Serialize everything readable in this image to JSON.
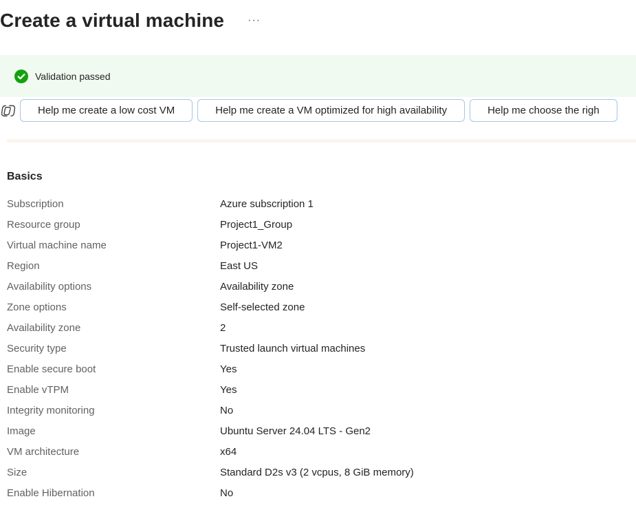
{
  "header": {
    "title": "Create a virtual machine",
    "more_label": "···"
  },
  "validation": {
    "text": "Validation passed",
    "color": "#13a10e"
  },
  "copilot": {
    "suggestions": [
      "Help me create a low cost VM",
      "Help me create a VM optimized for high availability",
      "Help me choose the righ"
    ]
  },
  "basics": {
    "heading": "Basics",
    "rows": [
      {
        "label": "Subscription",
        "value": "Azure subscription 1"
      },
      {
        "label": "Resource group",
        "value": "Project1_Group"
      },
      {
        "label": "Virtual machine name",
        "value": "Project1-VM2"
      },
      {
        "label": "Region",
        "value": "East US"
      },
      {
        "label": "Availability options",
        "value": "Availability zone"
      },
      {
        "label": "Zone options",
        "value": "Self-selected zone"
      },
      {
        "label": "Availability zone",
        "value": "2"
      },
      {
        "label": "Security type",
        "value": "Trusted launch virtual machines"
      },
      {
        "label": "Enable secure boot",
        "value": "Yes"
      },
      {
        "label": "Enable vTPM",
        "value": "Yes"
      },
      {
        "label": "Integrity monitoring",
        "value": "No"
      },
      {
        "label": "Image",
        "value": "Ubuntu Server 24.04 LTS - Gen2"
      },
      {
        "label": "VM architecture",
        "value": "x64"
      },
      {
        "label": "Size",
        "value": "Standard D2s v3 (2 vcpus, 8 GiB memory)"
      },
      {
        "label": "Enable Hibernation",
        "value": "No"
      }
    ]
  }
}
